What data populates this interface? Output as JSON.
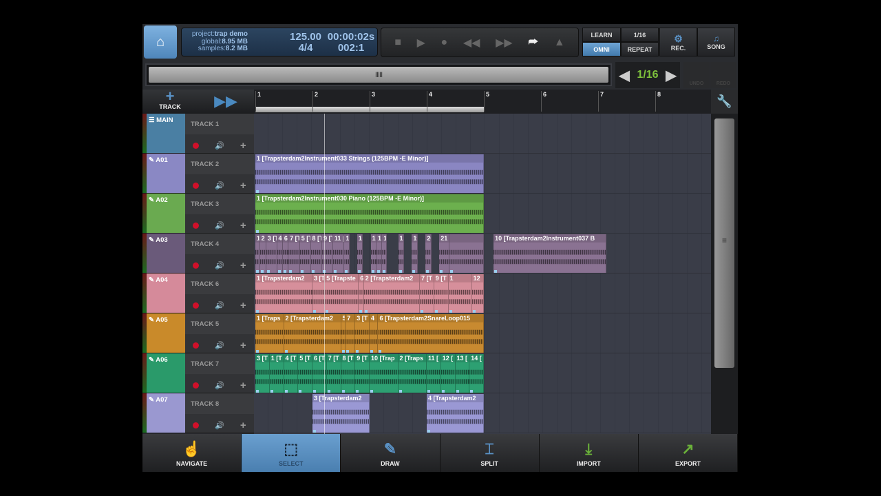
{
  "header": {
    "project_label": "project:",
    "project": "trap demo",
    "global_label": "global:",
    "global": "8.95 MB",
    "samples_label": "samples:",
    "samples": "8.2 MB",
    "tempo": "125.00",
    "time": "00:00:02s",
    "signature": "4/4",
    "position": "002:1"
  },
  "transport": {
    "icons": [
      "stop-icon",
      "play-icon",
      "record-icon",
      "rewind-icon",
      "fast-forward-icon",
      "loop-icon",
      "metronome-icon"
    ],
    "loop_active": true
  },
  "midi": {
    "learn": "LEARN",
    "omni": "OMNI",
    "quant": "1/16",
    "repeat": "REPEAT",
    "rec": "REC.",
    "song": "SONG"
  },
  "scroll": {
    "grip": "IIIII"
  },
  "quantize": {
    "value": "1/16"
  },
  "history": {
    "undo": "UNDO",
    "redo": "REDO"
  },
  "toolbar": {
    "add_track": "TRACK"
  },
  "ruler": {
    "bars": [
      "1",
      "2",
      "3",
      "4",
      "5",
      "6",
      "7",
      "8"
    ],
    "loop_start_bar": 1,
    "loop_end_bar": 5,
    "playhead_bar": 2.2
  },
  "colors": {
    "accent": "#5a92c6",
    "quantize": "#7ec23c",
    "record": "#d0102a"
  },
  "tracks": [
    {
      "tag": "MAIN",
      "name": "TRACK 1",
      "color": "#4a7fa3",
      "clip_color": "#4a7fa3",
      "clips": []
    },
    {
      "tag": "A01",
      "name": "TRACK 2",
      "color": "#8a88c4",
      "clip_color": "#8a86c2",
      "clips": [
        {
          "label": "1 [Trapsterdam2Instrument033 Strings (125BPM -E Minor)]",
          "start": 1,
          "end": 5
        }
      ]
    },
    {
      "tag": "A02",
      "name": "TRACK 3",
      "color": "#6aaa50",
      "clip_color": "#6cb04e",
      "clips": [
        {
          "label": "1 [Trapsterdam2Instrument030 Piano (125BPM -E Minor)]",
          "start": 1,
          "end": 5
        }
      ]
    },
    {
      "tag": "A03",
      "name": "TRACK 4",
      "color": "#6a5a7a",
      "clip_color": "#8a7292",
      "clips": [
        {
          "label": "1",
          "start": 1,
          "end": 1.08
        },
        {
          "label": "2",
          "start": 1.08,
          "end": 1.19
        },
        {
          "label": "3 [T",
          "start": 1.19,
          "end": 1.38
        },
        {
          "label": "4",
          "start": 1.38,
          "end": 1.48
        },
        {
          "label": "6",
          "start": 1.48,
          "end": 1.58
        },
        {
          "label": "7 [T",
          "start": 1.58,
          "end": 1.78
        },
        {
          "label": "5 [T",
          "start": 1.78,
          "end": 1.97
        },
        {
          "label": "8 [T",
          "start": 1.97,
          "end": 2.17
        },
        {
          "label": "9 [T",
          "start": 2.17,
          "end": 2.36
        },
        {
          "label": "11 [",
          "start": 2.36,
          "end": 2.56
        },
        {
          "label": "1:",
          "start": 2.56,
          "end": 2.65
        },
        {
          "label": "14",
          "start": 2.78,
          "end": 2.88
        },
        {
          "label": "1(",
          "start": 3.02,
          "end": 3.12
        },
        {
          "label": "18",
          "start": 3.12,
          "end": 3.22
        },
        {
          "label": "1",
          "start": 3.22,
          "end": 3.3
        },
        {
          "label": "15",
          "start": 3.5,
          "end": 3.6
        },
        {
          "label": "19",
          "start": 3.74,
          "end": 3.84
        },
        {
          "label": "20",
          "start": 3.98,
          "end": 4.08
        },
        {
          "label": "21 [",
          "start": 4.22,
          "end": 4.4
        },
        {
          "label": "",
          "start": 4.4,
          "end": 5
        },
        {
          "label": "10 [Trapsterdam2Instrument037 B",
          "start": 5.17,
          "end": 7.15
        }
      ]
    },
    {
      "tag": "A04",
      "name": "TRACK 6",
      "color": "#d58a9a",
      "clip_color": "#d68f9b",
      "clips": [
        {
          "label": "1 [Trapsterdam2",
          "start": 1,
          "end": 2.0
        },
        {
          "label": "3 [T",
          "start": 2.0,
          "end": 2.22
        },
        {
          "label": "5 [Trapste",
          "start": 2.22,
          "end": 2.81
        },
        {
          "label": "6",
          "start": 2.81,
          "end": 2.9
        },
        {
          "label": "2 [Trapsterdam2",
          "start": 2.9,
          "end": 3.88
        },
        {
          "label": "7 [T",
          "start": 3.88,
          "end": 4.13
        },
        {
          "label": "9 [T",
          "start": 4.13,
          "end": 4.38
        },
        {
          "label": "1",
          "start": 4.38,
          "end": 4.79
        },
        {
          "label": "12",
          "start": 4.79,
          "end": 5
        }
      ]
    },
    {
      "tag": "A05",
      "name": "TRACK 5",
      "color": "#c98a2a",
      "clip_color": "#c88a30",
      "clips": [
        {
          "label": "1 [Traps",
          "start": 1,
          "end": 1.5
        },
        {
          "label": "2 [Trapsterdam2",
          "start": 1.5,
          "end": 2.5
        },
        {
          "label": "5",
          "start": 2.5,
          "end": 2.58
        },
        {
          "label": "7",
          "start": 2.58,
          "end": 2.75
        },
        {
          "label": "3 [T",
          "start": 2.75,
          "end": 3.0
        },
        {
          "label": "4",
          "start": 3.0,
          "end": 3.15
        },
        {
          "label": "6 [Trapsterdam2SnareLoop015",
          "start": 3.15,
          "end": 5
        }
      ]
    },
    {
      "tag": "A06",
      "name": "TRACK 7",
      "color": "#2a9a6a",
      "clip_color": "#2da072",
      "clips": [
        {
          "label": "3 [T",
          "start": 1,
          "end": 1.25
        },
        {
          "label": "1 [T",
          "start": 1.25,
          "end": 1.5
        },
        {
          "label": "4 [T",
          "start": 1.5,
          "end": 1.75
        },
        {
          "label": "5 [T",
          "start": 1.75,
          "end": 2.0
        },
        {
          "label": "6 [T",
          "start": 2.0,
          "end": 2.25
        },
        {
          "label": "7 [T",
          "start": 2.25,
          "end": 2.5
        },
        {
          "label": "8 [T",
          "start": 2.5,
          "end": 2.75
        },
        {
          "label": "9 [T",
          "start": 2.75,
          "end": 3.0
        },
        {
          "label": "10 [Trap",
          "start": 3.0,
          "end": 3.5
        },
        {
          "label": "2 [Traps",
          "start": 3.5,
          "end": 4.0
        },
        {
          "label": "11 [",
          "start": 4.0,
          "end": 4.25
        },
        {
          "label": "12 [",
          "start": 4.25,
          "end": 4.5
        },
        {
          "label": "13 [",
          "start": 4.5,
          "end": 4.75
        },
        {
          "label": "14 [",
          "start": 4.75,
          "end": 5
        }
      ]
    },
    {
      "tag": "A07",
      "name": "TRACK 8",
      "color": "#9a98d0",
      "clip_color": "#9a98d4",
      "clips": [
        {
          "label": "3 [Trapsterdam2",
          "start": 2,
          "end": 3
        },
        {
          "label": "4 [Trapsterdam2",
          "start": 4,
          "end": 5
        }
      ]
    }
  ],
  "tools": [
    {
      "label": "NAVIGATE",
      "icon": "hand-icon",
      "glyph": "☝",
      "selected": false
    },
    {
      "label": "SELECT",
      "icon": "select-icon",
      "glyph": "⬚",
      "selected": true
    },
    {
      "label": "DRAW",
      "icon": "pencil-icon",
      "glyph": "✎",
      "selected": false
    },
    {
      "label": "SPLIT",
      "icon": "split-icon",
      "glyph": "⌶",
      "selected": false
    },
    {
      "label": "IMPORT",
      "icon": "import-icon",
      "glyph": "⤓",
      "selected": false
    },
    {
      "label": "EXPORT",
      "icon": "export-icon",
      "glyph": "↗",
      "selected": false
    }
  ]
}
